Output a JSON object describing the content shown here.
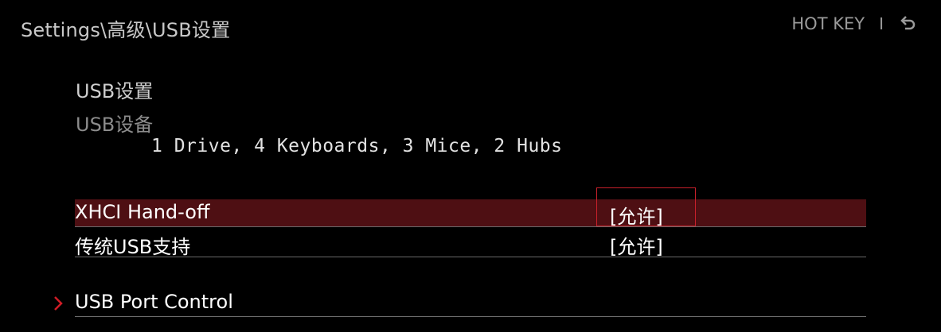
{
  "header": {
    "breadcrumb": "Settings\\高级\\USB设置",
    "hotkey_label": "HOT KEY",
    "separator": "I",
    "back_icon": "back-arrow-icon"
  },
  "main": {
    "section_title": "USB设置",
    "devices_label": "USB设备",
    "devices_value": "1 Drive, 4 Keyboards, 3 Mice, 2 Hubs",
    "items": [
      {
        "label": "XHCI Hand-off",
        "value": "[允许]",
        "selected": true
      },
      {
        "label": "传统USB支持",
        "value": "[允许]",
        "selected": false
      },
      {
        "label": "USB Port Control",
        "submenu": true,
        "icon": "chevron-right-icon"
      }
    ]
  },
  "colors": {
    "background": "#000000",
    "selected_row": "#4e0f13",
    "focus_border": "#c8202b",
    "accent_chevron": "#d01c26"
  }
}
